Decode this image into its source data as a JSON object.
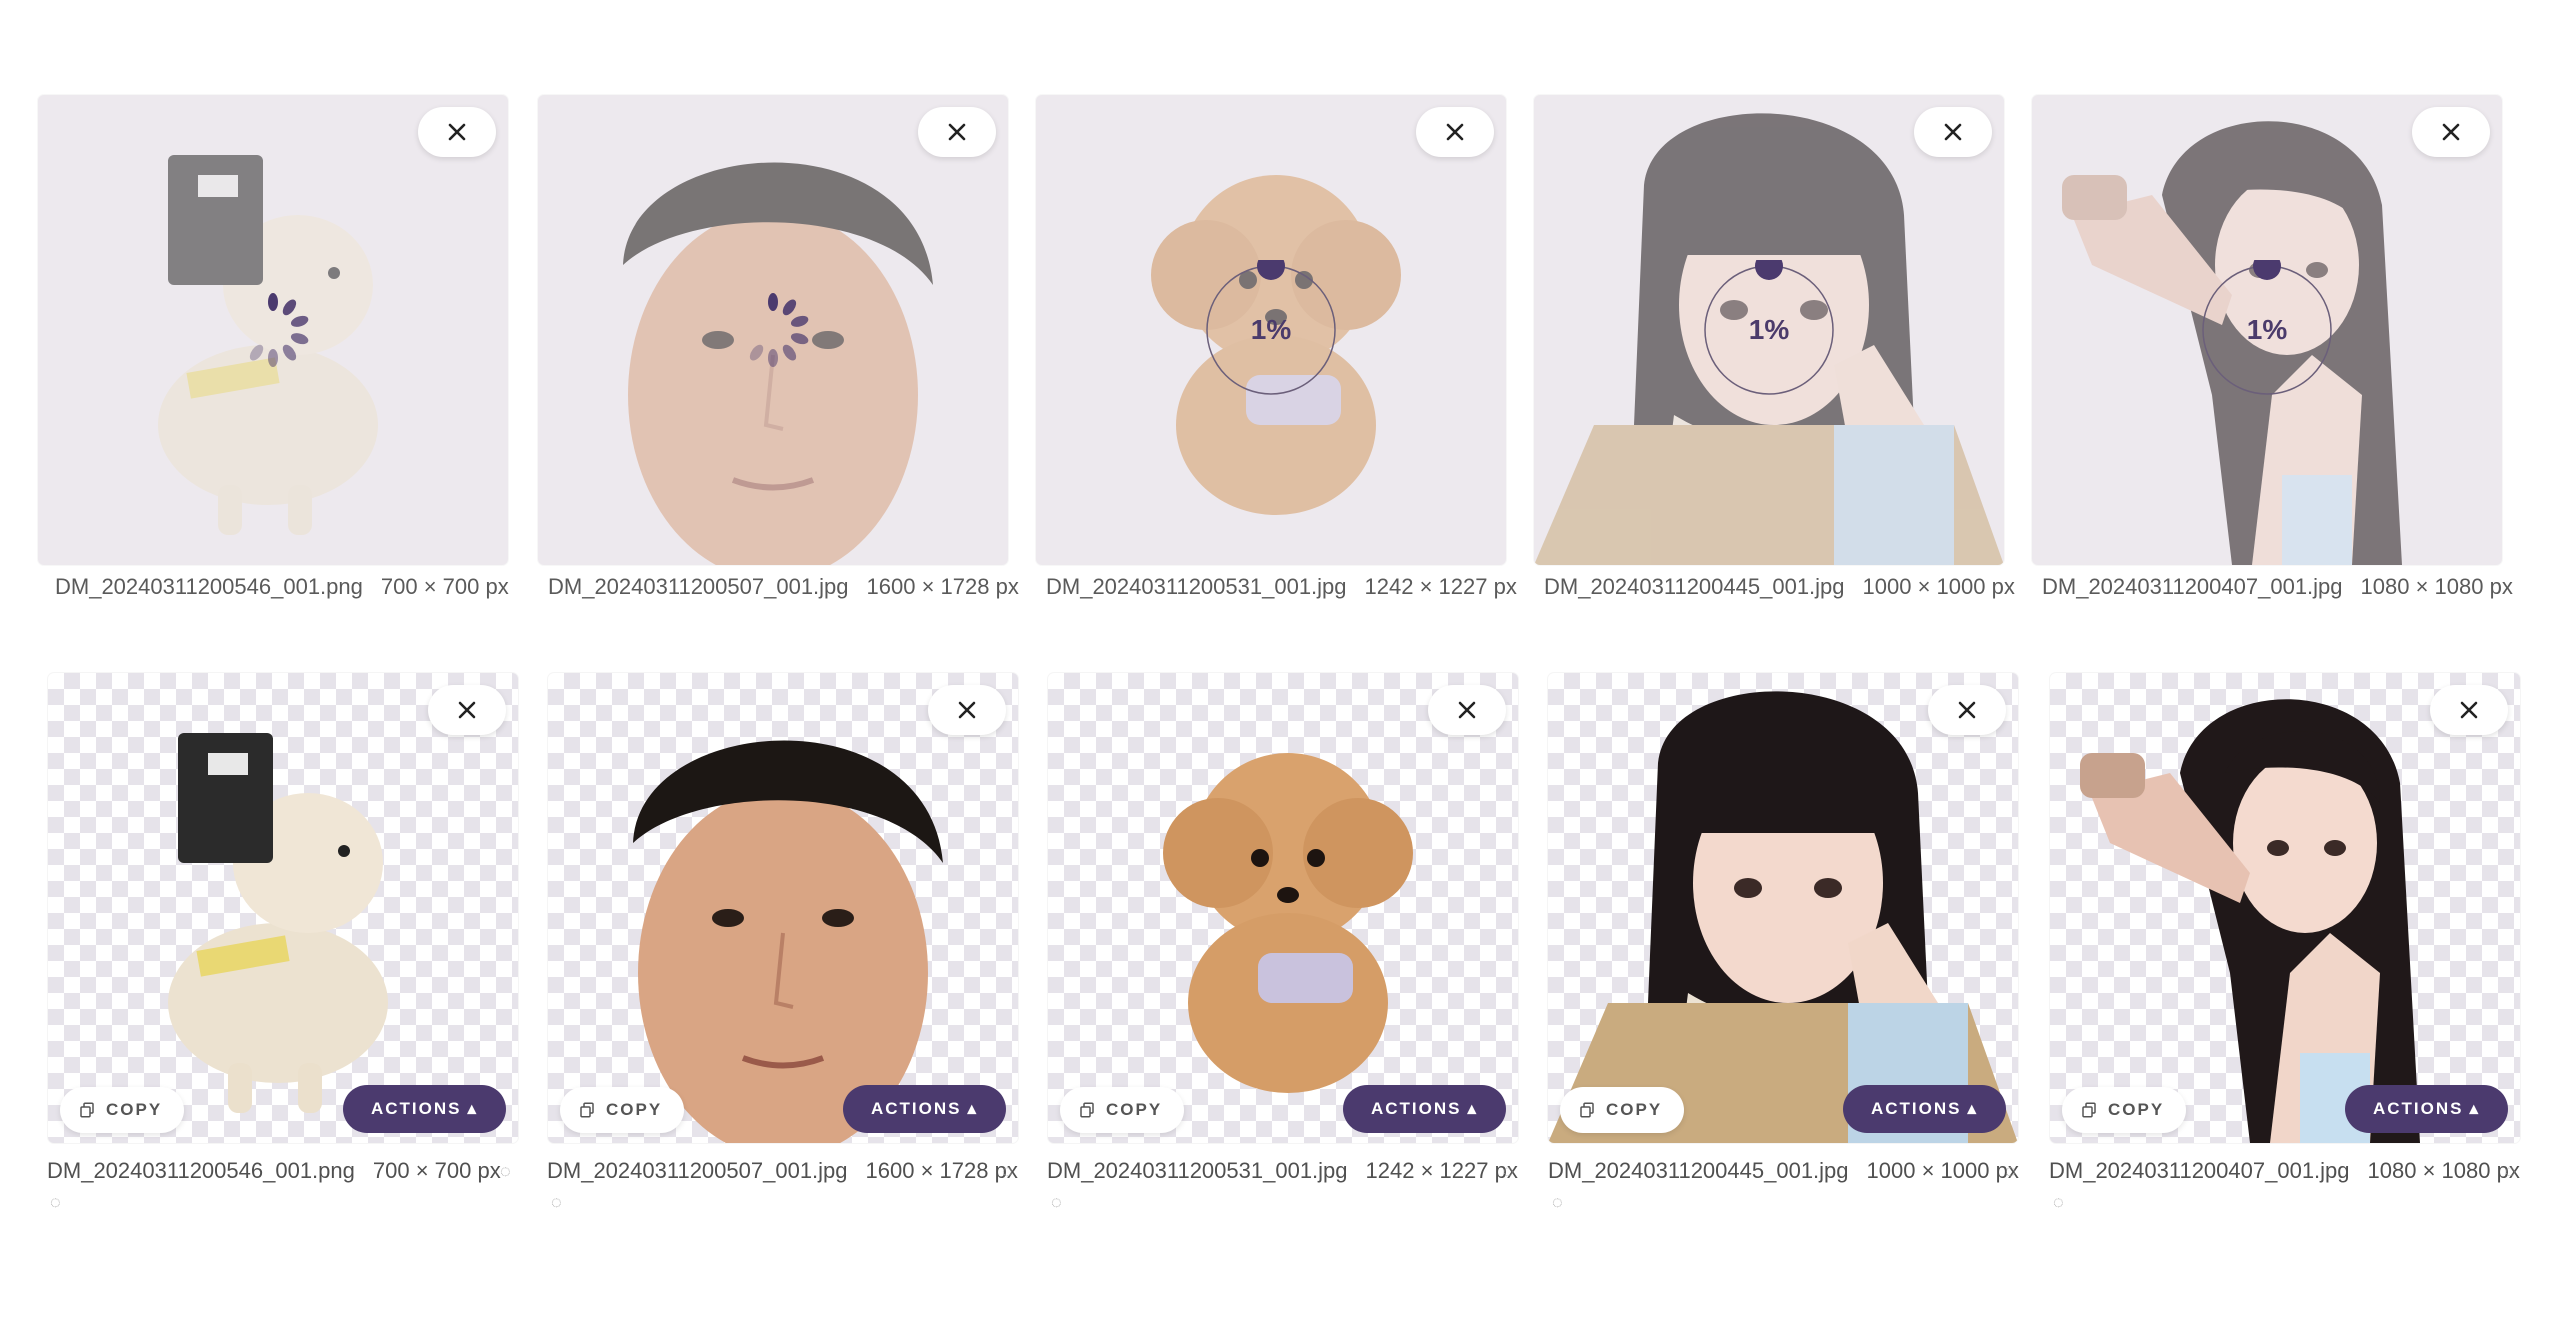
{
  "close_icon": "close-icon",
  "loading_row": [
    {
      "filename": "DM_20240311200546_001.png",
      "dims": "700 × 700 px",
      "state": "spinner"
    },
    {
      "filename": "DM_20240311200507_001.jpg",
      "dims": "1600 × 1728 px",
      "state": "spinner"
    },
    {
      "filename": "DM_20240311200531_001.jpg",
      "dims": "1242 × 1227 px",
      "state": "progress",
      "progress_label": "1%",
      "progress": 0.01
    },
    {
      "filename": "DM_20240311200445_001.jpg",
      "dims": "1000 × 1000 px",
      "state": "progress",
      "progress_label": "1%",
      "progress": 0.01
    },
    {
      "filename": "DM_20240311200407_001.jpg",
      "dims": "1080 × 1080 px",
      "state": "progress",
      "progress_label": "1%",
      "progress": 0.01
    }
  ],
  "result_row": [
    {
      "filename": "DM_20240311200546_001.png",
      "dims": "700 × 700 px",
      "copy_label": "COPY",
      "actions_label": "ACTIONS"
    },
    {
      "filename": "DM_20240311200507_001.jpg",
      "dims": "1600 × 1728 px",
      "copy_label": "COPY",
      "actions_label": "ACTIONS"
    },
    {
      "filename": "DM_20240311200531_001.jpg",
      "dims": "1242 × 1227 px",
      "copy_label": "COPY",
      "actions_label": "ACTIONS"
    },
    {
      "filename": "DM_20240311200445_001.jpg",
      "dims": "1000 × 1000 px",
      "copy_label": "COPY",
      "actions_label": "ACTIONS"
    },
    {
      "filename": "DM_20240311200407_001.jpg",
      "dims": "1080 × 1080 px",
      "copy_label": "COPY",
      "actions_label": "ACTIONS"
    }
  ],
  "colors": {
    "accent": "#4b3a6e",
    "checker": "#e6e3ea",
    "loading_bg": "#ede9ee"
  }
}
